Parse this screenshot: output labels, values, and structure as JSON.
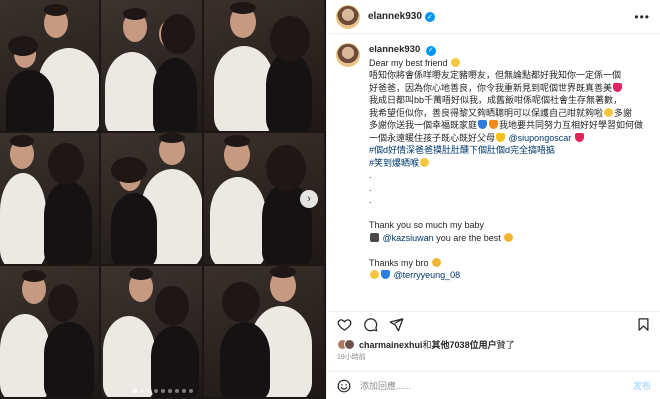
{
  "post": {
    "username": "elannek930",
    "verified_mark": "✓",
    "more_icon": "•••"
  },
  "caption": {
    "username": "elannek930",
    "lines": [
      "Dear my best friend",
      "唔知你將會係咩嘢友定豬嘢友，但無論點都好我知你一定係一個",
      "好爸爸，因為你心地善良，你令我重新見到呢個世界既真善美",
      "我成日都叫bb千萬唔好似我，成舊飯咁係呢個社會生存無著數，",
      "我希望佢似你，善良得黎又夠晒聰明可以保護自己咁就夠啦",
      "多謝你送我一個幸福既家庭",
      "我地要共同努力互相好好學習如何做",
      "一個永遠暖住孩子既心既好父母",
      "@siupongoscar",
      "#個d好情深爸爸摸肚肚醺下個肚個d完全搞唔掂",
      "#笑到爆晒喉",
      ".",
      ".",
      ".",
      "Thank you so much my baby",
      "@kazsiuwan",
      "you are the best",
      "Thanks my bro",
      "@terryyeung_08"
    ]
  },
  "likes": {
    "liker": "charmainexhui",
    "and_text": "和",
    "others": "其他7038位用户",
    "suffix": "贊了"
  },
  "timestamp": "19小時前",
  "comment": {
    "placeholder": "添加回應......",
    "post_label": "发布"
  },
  "media": {
    "arrow": "›",
    "dots_total": 9,
    "dots_active_index": 0
  },
  "colors": {
    "link": "#00376b",
    "verified": "#0095f6",
    "post_button": "#b2dffc",
    "muted": "#8e8e8e"
  },
  "icons": [
    "heart-icon",
    "comment-icon",
    "share-icon",
    "bookmark-icon",
    "emoji-icon"
  ]
}
